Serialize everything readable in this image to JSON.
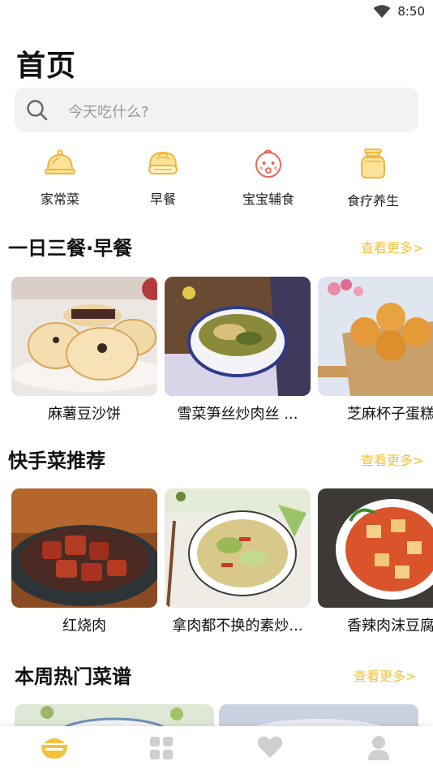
{
  "status_bar": {
    "time": "8:50",
    "icons": [
      "wifi-icon"
    ]
  },
  "page": {
    "title": "首页"
  },
  "search": {
    "placeholder": "今天吃什么?"
  },
  "categories": [
    {
      "label": "家常菜",
      "icon": "cloche-icon"
    },
    {
      "label": "早餐",
      "icon": "steamed-bun-icon"
    },
    {
      "label": "宝宝辅食",
      "icon": "baby-face-icon"
    },
    {
      "label": "食疗养生",
      "icon": "jar-icon"
    }
  ],
  "sections": [
    {
      "title": "一日三餐·早餐",
      "more": "查看更多>",
      "cards": [
        {
          "caption": "麻薯豆沙饼"
        },
        {
          "caption": "雪菜笋丝炒肉丝 ..."
        },
        {
          "caption": "芝麻杯子蛋糕"
        }
      ]
    },
    {
      "title": "快手菜推荐",
      "more": "查看更多>",
      "cards": [
        {
          "caption": "红烧肉"
        },
        {
          "caption": "拿肉都不换的素炒..."
        },
        {
          "caption": "香辣肉沫豆腐"
        }
      ]
    },
    {
      "title": "本周热门菜谱",
      "more": "查看更多>"
    }
  ],
  "tabbar": {
    "active_color": "#f3c23b",
    "inactive_color": "#cfcfcf",
    "tabs": [
      "home-bowl-icon",
      "grid-icon",
      "heart-icon",
      "profile-icon"
    ]
  },
  "colors": {
    "accent": "#f3c23b",
    "category_icon": "#f5b43c",
    "baby_icon": "#e8685a"
  }
}
